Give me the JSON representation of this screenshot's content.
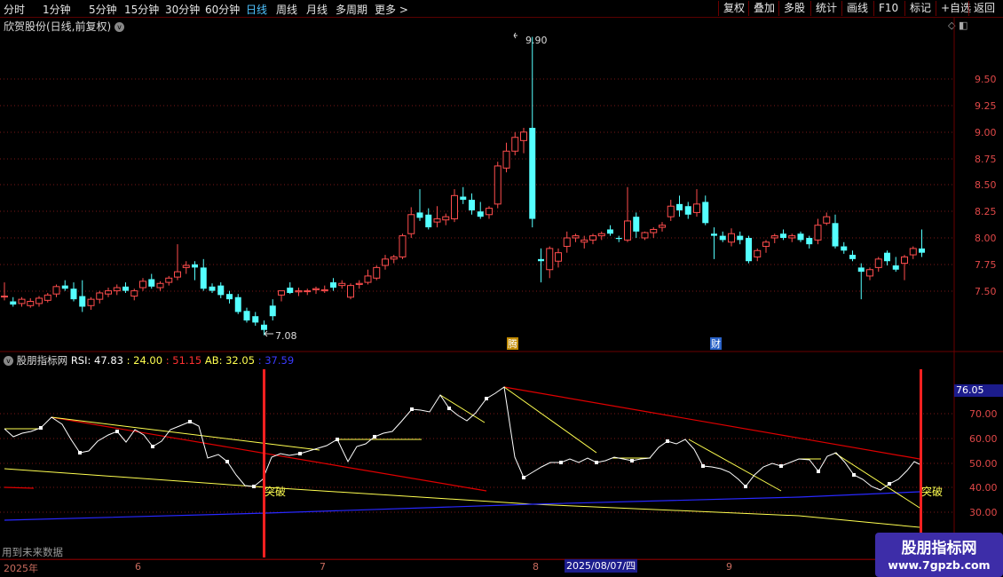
{
  "toolbar": {
    "periods": [
      "分时",
      "1分钟",
      "5分钟",
      "15分钟",
      "30分钟",
      "60分钟",
      "日线",
      "周线",
      "月线",
      "多周期",
      "更多"
    ],
    "active_period": "日线",
    "more_arrow": ">",
    "actions": [
      "复权",
      "叠加",
      "多股",
      "统计",
      "画线",
      "F10",
      "标记",
      "+自选",
      "返回"
    ]
  },
  "main_chart": {
    "title": "欣贺股份(日线,前复权)",
    "collapse_icon": "v",
    "tool_icons": "◇ ◧",
    "price_axis": [
      "9.50",
      "9.25",
      "9.00",
      "8.75",
      "8.50",
      "8.25",
      "8.00",
      "7.75",
      "7.50"
    ],
    "high_label": "9.90",
    "low_label": "7.08",
    "event_markers": [
      "腾",
      "财"
    ]
  },
  "indicator": {
    "name": "股朋指标网",
    "rsi_label": "RSI: 47.83",
    "v1_label": ": 24.00",
    "v2_label": ": 51.15",
    "ab_label": "AB: 32.05",
    "v3_label": ": 37.59",
    "current_value": "76.05",
    "axis": [
      "70.00",
      "60.00",
      "50.00",
      "40.00",
      "30.00"
    ],
    "breakout_label": "突破",
    "future_note": "用到未来数据"
  },
  "date_axis": {
    "labels": [
      "2025年",
      "6",
      "7",
      "8",
      "9"
    ],
    "cursor": "2025/08/07/四"
  },
  "watermark": {
    "title": "股朋指标网",
    "url": "www.7gpzb.com"
  },
  "colors": {
    "up": "#ff4d4d",
    "down": "#54ffff",
    "rsi": "#ffffff",
    "yellow": "#ffff50",
    "red": "#e00000",
    "blue": "#2020ff",
    "grid": "#7a1818"
  },
  "chart_data": {
    "type": "candlestick",
    "approximate": true,
    "price_range": [
      7.08,
      9.9
    ],
    "ohlc": [
      [
        7.45,
        7.58,
        7.41,
        7.45
      ],
      [
        7.4,
        7.44,
        7.35,
        7.37
      ],
      [
        7.38,
        7.44,
        7.35,
        7.42
      ],
      [
        7.36,
        7.43,
        7.34,
        7.4
      ],
      [
        7.38,
        7.45,
        7.35,
        7.43
      ],
      [
        7.41,
        7.48,
        7.39,
        7.46
      ],
      [
        7.47,
        7.56,
        7.44,
        7.54
      ],
      [
        7.55,
        7.6,
        7.5,
        7.52
      ],
      [
        7.52,
        7.58,
        7.4,
        7.42
      ],
      [
        7.45,
        7.6,
        7.3,
        7.35
      ],
      [
        7.36,
        7.44,
        7.32,
        7.42
      ],
      [
        7.42,
        7.5,
        7.38,
        7.48
      ],
      [
        7.47,
        7.53,
        7.44,
        7.5
      ],
      [
        7.5,
        7.56,
        7.46,
        7.53
      ],
      [
        7.54,
        7.58,
        7.48,
        7.5
      ],
      [
        7.45,
        7.52,
        7.41,
        7.5
      ],
      [
        7.53,
        7.62,
        7.5,
        7.59
      ],
      [
        7.61,
        7.66,
        7.52,
        7.54
      ],
      [
        7.53,
        7.59,
        7.5,
        7.57
      ],
      [
        7.58,
        7.64,
        7.55,
        7.62
      ],
      [
        7.63,
        7.94,
        7.6,
        7.68
      ],
      [
        7.72,
        7.78,
        7.66,
        7.74
      ],
      [
        7.75,
        7.78,
        7.6,
        7.72
      ],
      [
        7.72,
        7.8,
        7.5,
        7.52
      ],
      [
        7.54,
        7.57,
        7.48,
        7.5
      ],
      [
        7.55,
        7.58,
        7.43,
        7.46
      ],
      [
        7.47,
        7.5,
        7.38,
        7.42
      ],
      [
        7.44,
        7.47,
        7.28,
        7.3
      ],
      [
        7.31,
        7.34,
        7.2,
        7.22
      ],
      [
        7.26,
        7.3,
        7.17,
        7.2
      ],
      [
        7.18,
        7.22,
        7.08,
        7.13
      ],
      [
        7.36,
        7.42,
        7.22,
        7.26
      ],
      [
        7.46,
        7.5,
        7.4,
        7.5
      ],
      [
        7.53,
        7.58,
        7.47,
        7.48
      ],
      [
        7.49,
        7.53,
        7.45,
        7.5
      ],
      [
        7.5,
        7.52,
        7.46,
        7.5
      ],
      [
        7.51,
        7.54,
        7.47,
        7.52
      ],
      [
        7.5,
        7.55,
        7.48,
        7.51
      ],
      [
        7.58,
        7.62,
        7.5,
        7.53
      ],
      [
        7.55,
        7.6,
        7.52,
        7.57
      ],
      [
        7.44,
        7.57,
        7.42,
        7.55
      ],
      [
        7.56,
        7.6,
        7.52,
        7.57
      ],
      [
        7.58,
        7.7,
        7.56,
        7.64
      ],
      [
        7.62,
        7.74,
        7.6,
        7.72
      ],
      [
        7.74,
        7.84,
        7.7,
        7.8
      ],
      [
        7.8,
        7.84,
        7.76,
        7.82
      ],
      [
        7.82,
        8.04,
        7.8,
        8.02
      ],
      [
        8.04,
        8.29,
        8.0,
        8.22
      ],
      [
        8.24,
        8.46,
        8.16,
        8.19
      ],
      [
        8.22,
        8.28,
        8.08,
        8.1
      ],
      [
        8.15,
        8.3,
        8.1,
        8.18
      ],
      [
        8.17,
        8.23,
        8.12,
        8.2
      ],
      [
        8.18,
        8.46,
        8.15,
        8.4
      ],
      [
        8.39,
        8.48,
        8.32,
        8.36
      ],
      [
        8.36,
        8.42,
        8.22,
        8.26
      ],
      [
        8.25,
        8.34,
        8.18,
        8.2
      ],
      [
        8.22,
        8.3,
        8.18,
        8.28
      ],
      [
        8.32,
        8.72,
        8.28,
        8.68
      ],
      [
        8.66,
        8.9,
        8.62,
        8.82
      ],
      [
        8.82,
        9.0,
        8.78,
        8.95
      ],
      [
        8.92,
        9.04,
        8.8,
        9.0
      ],
      [
        9.04,
        9.9,
        8.1,
        8.18
      ],
      [
        7.8,
        7.9,
        7.58,
        7.78
      ],
      [
        7.7,
        7.92,
        7.62,
        7.9
      ],
      [
        7.78,
        7.9,
        7.72,
        7.86
      ],
      [
        7.92,
        8.06,
        7.86,
        8.0
      ],
      [
        8.0,
        8.04,
        7.96,
        8.02
      ],
      [
        7.96,
        8.02,
        7.9,
        7.98
      ],
      [
        7.98,
        8.04,
        7.94,
        8.02
      ],
      [
        8.02,
        8.06,
        7.98,
        8.04
      ],
      [
        8.08,
        8.12,
        8.02,
        8.04
      ],
      [
        8.0,
        8.02,
        7.96,
        7.99
      ],
      [
        7.98,
        8.48,
        7.96,
        8.16
      ],
      [
        8.2,
        8.24,
        8.0,
        8.06
      ],
      [
        8.0,
        8.06,
        7.98,
        8.05
      ],
      [
        8.05,
        8.1,
        8.0,
        8.08
      ],
      [
        8.1,
        8.15,
        8.06,
        8.12
      ],
      [
        8.2,
        8.36,
        8.16,
        8.3
      ],
      [
        8.32,
        8.4,
        8.2,
        8.26
      ],
      [
        8.3,
        8.34,
        8.18,
        8.22
      ],
      [
        8.24,
        8.46,
        8.2,
        8.32
      ],
      [
        8.34,
        8.4,
        8.12,
        8.14
      ],
      [
        8.04,
        8.1,
        7.8,
        8.02
      ],
      [
        8.02,
        8.06,
        7.96,
        7.98
      ],
      [
        7.96,
        8.09,
        7.92,
        8.04
      ],
      [
        8.02,
        8.06,
        7.94,
        7.98
      ],
      [
        8.0,
        8.02,
        7.76,
        7.78
      ],
      [
        7.82,
        7.9,
        7.78,
        7.88
      ],
      [
        7.92,
        7.98,
        7.86,
        7.96
      ],
      [
        8.0,
        8.04,
        7.95,
        8.02
      ],
      [
        8.04,
        8.08,
        7.98,
        8.0
      ],
      [
        8.0,
        8.04,
        7.96,
        8.02
      ],
      [
        8.04,
        8.06,
        7.96,
        7.98
      ],
      [
        8.0,
        8.02,
        7.9,
        7.94
      ],
      [
        7.98,
        8.18,
        7.94,
        8.12
      ],
      [
        8.14,
        8.24,
        8.12,
        8.2
      ],
      [
        8.14,
        8.22,
        7.9,
        7.92
      ],
      [
        7.92,
        7.96,
        7.85,
        7.88
      ],
      [
        7.84,
        7.88,
        7.78,
        7.8
      ],
      [
        7.72,
        7.76,
        7.42,
        7.68
      ],
      [
        7.64,
        7.72,
        7.6,
        7.7
      ],
      [
        7.72,
        7.82,
        7.68,
        7.8
      ],
      [
        7.86,
        7.88,
        7.74,
        7.78
      ],
      [
        7.74,
        7.82,
        7.68,
        7.7
      ],
      [
        7.76,
        7.84,
        7.6,
        7.82
      ],
      [
        7.84,
        7.92,
        7.8,
        7.9
      ],
      [
        7.9,
        8.08,
        7.82,
        7.86
      ]
    ]
  }
}
